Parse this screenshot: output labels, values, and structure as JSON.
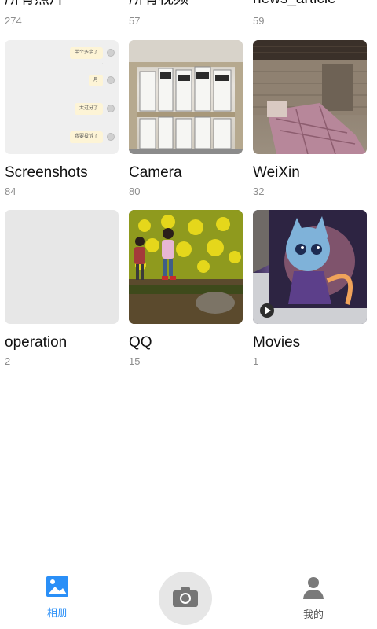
{
  "albums": [
    {
      "name": "所有照片",
      "count": "274"
    },
    {
      "name": "所有视频",
      "count": "57"
    },
    {
      "name": "news_article",
      "count": "59"
    },
    {
      "name": "Screenshots",
      "count": "84"
    },
    {
      "name": "Camera",
      "count": "80"
    },
    {
      "name": "WeiXin",
      "count": "32"
    },
    {
      "name": "operation",
      "count": "2"
    },
    {
      "name": "QQ",
      "count": "15"
    },
    {
      "name": "Movies",
      "count": "1"
    }
  ],
  "chat_bubbles": [
    "半个多余了",
    "月",
    "太过分了",
    "我要投诉了"
  ],
  "nav": {
    "albums_label": "相册",
    "mine_label": "我的",
    "active_color": "#2a8ff7",
    "inactive_color": "#7a7a7a"
  },
  "icons": {
    "albums": "picture-icon",
    "camera": "camera-icon",
    "mine": "person-icon"
  }
}
